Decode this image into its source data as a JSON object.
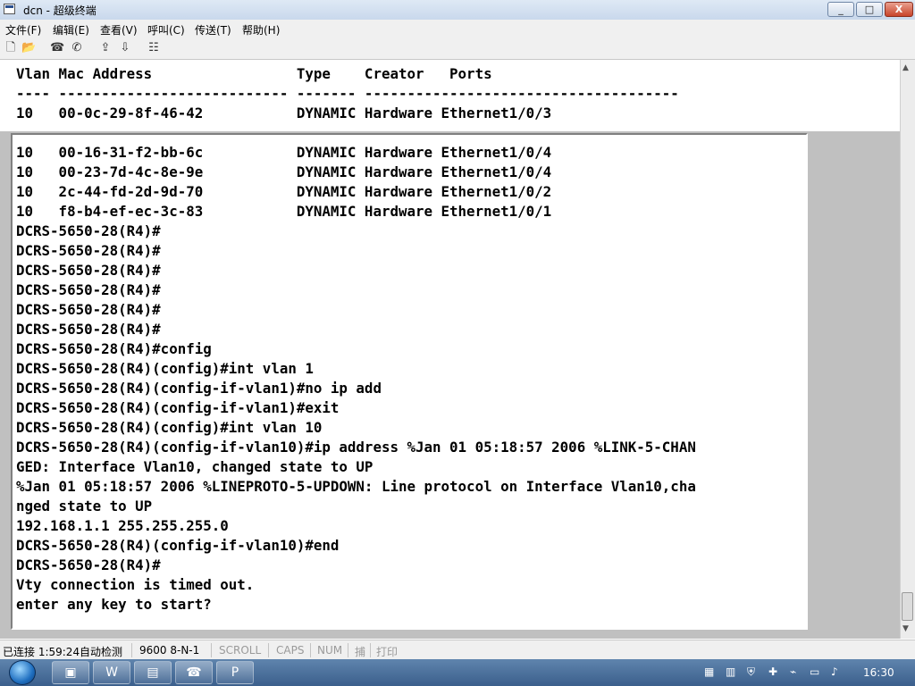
{
  "window": {
    "title": "dcn - 超级终端",
    "min": "_",
    "max": "□",
    "close": "X"
  },
  "menu": [
    {
      "label": "文件(F)"
    },
    {
      "label": "编辑(E)"
    },
    {
      "label": "查看(V)"
    },
    {
      "label": "呼叫(C)"
    },
    {
      "label": "传送(T)"
    },
    {
      "label": "帮助(H)"
    }
  ],
  "toolbar": [
    "new-icon",
    "open-icon",
    "disconnect-icon",
    "call-icon",
    "send-icon",
    "receive-icon",
    "properties-icon"
  ],
  "terminal": {
    "top_lines": [
      "Vlan Mac Address                 Type    Creator   Ports",
      "---- --------------------------- ------- -------------------------------------",
      "10   00-0c-29-8f-46-42           DYNAMIC Hardware Ethernet1/0/3"
    ],
    "lines": [
      "10   00-16-31-f2-bb-6c           DYNAMIC Hardware Ethernet1/0/4",
      "10   00-23-7d-4c-8e-9e           DYNAMIC Hardware Ethernet1/0/4",
      "10   2c-44-fd-2d-9d-70           DYNAMIC Hardware Ethernet1/0/2",
      "10   f8-b4-ef-ec-3c-83           DYNAMIC Hardware Ethernet1/0/1",
      "DCRS-5650-28(R4)#",
      "DCRS-5650-28(R4)#",
      "DCRS-5650-28(R4)#",
      "DCRS-5650-28(R4)#",
      "DCRS-5650-28(R4)#",
      "DCRS-5650-28(R4)#",
      "DCRS-5650-28(R4)#config",
      "DCRS-5650-28(R4)(config)#int vlan 1",
      "DCRS-5650-28(R4)(config-if-vlan1)#no ip add",
      "DCRS-5650-28(R4)(config-if-vlan1)#exit",
      "DCRS-5650-28(R4)(config)#int vlan 10",
      "DCRS-5650-28(R4)(config-if-vlan10)#ip address %Jan 01 05:18:57 2006 %LINK-5-CHAN",
      "GED: Interface Vlan10, changed state to UP",
      "%Jan 01 05:18:57 2006 %LINEPROTO-5-UPDOWN: Line protocol on Interface Vlan10,cha",
      "nged state to UP",
      "192.168.1.1 255.255.255.0",
      "DCRS-5650-28(R4)(config-if-vlan10)#end",
      "DCRS-5650-28(R4)#",
      "Vty connection is timed out.",
      "enter any key to start?"
    ]
  },
  "status": {
    "connection": "已连接 1:59:24",
    "detect": "自动检测",
    "port": "9600 8-N-1",
    "scroll": "SCROLL",
    "caps": "CAPS",
    "num": "NUM",
    "capture": "捕",
    "print": "打印"
  },
  "taskbar": {
    "apps": [
      "explorer-icon",
      "word-icon",
      "folder-icon",
      "hyperterminal-icon",
      "powerpoint-icon"
    ],
    "clock": "16:30"
  }
}
